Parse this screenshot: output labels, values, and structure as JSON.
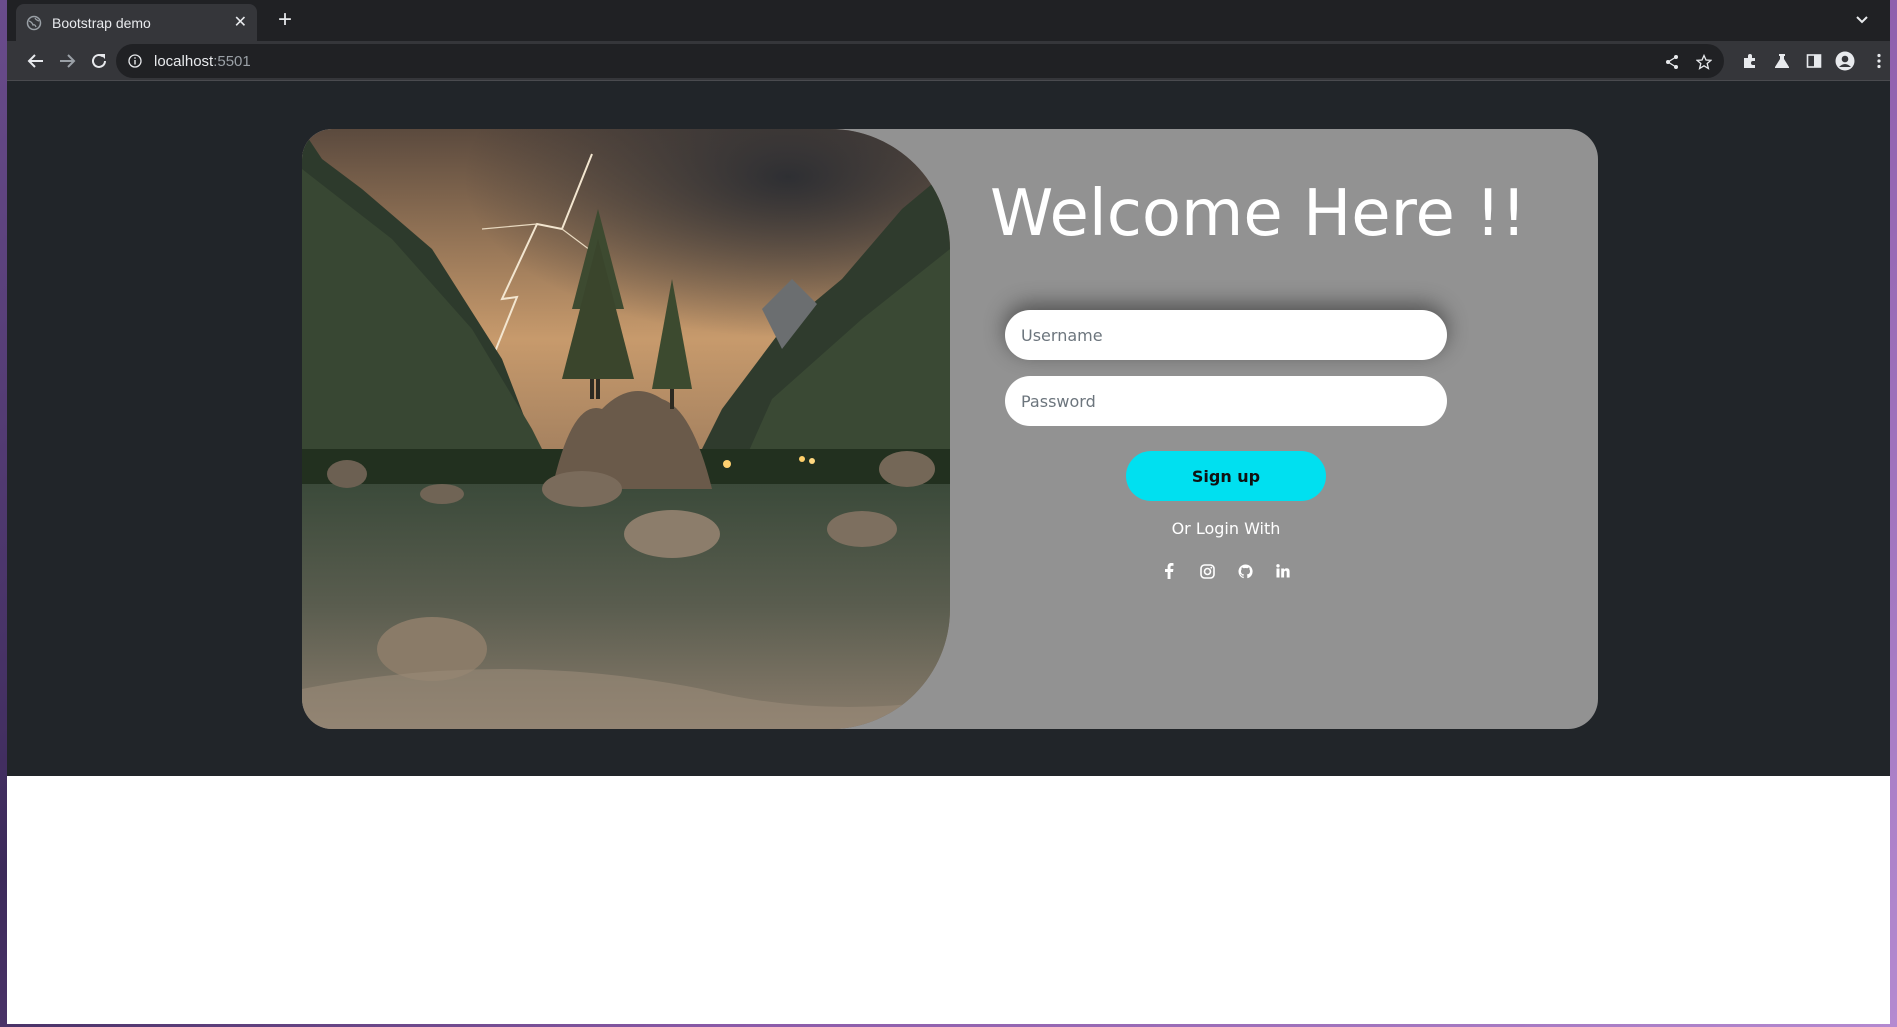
{
  "browser": {
    "tab_title": "Bootstrap demo",
    "tab_close": "✕",
    "new_tab": "+",
    "url_host": "localhost",
    "url_port": ":5501"
  },
  "page": {
    "heading": "Welcome Here !!",
    "username_placeholder": "Username",
    "password_placeholder": "Password",
    "signup_label": "Sign up",
    "or_login_text": "Or Login With",
    "social_icons": [
      "facebook-icon",
      "instagram-icon",
      "github-icon",
      "linkedin-icon"
    ]
  },
  "colors": {
    "page_bg": "#212529",
    "card_bg": "#929292",
    "button_bg": "#00e0f0",
    "browser_dark": "#202124",
    "browser_toolbar": "#35363a"
  }
}
